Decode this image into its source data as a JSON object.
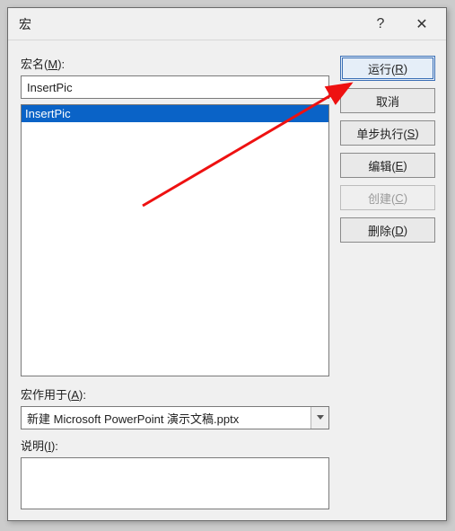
{
  "titlebar": {
    "title": "宏",
    "help_icon": "?",
    "close_icon": "✕"
  },
  "left_panel": {
    "name_label_prefix": "宏名(",
    "name_label_key": "M",
    "name_label_suffix": "):",
    "name_value": "InsertPic",
    "list_items": [
      "InsertPic"
    ],
    "selected_index": 0,
    "scope_label_prefix": "宏作用于(",
    "scope_label_key": "A",
    "scope_label_suffix": "):",
    "scope_value": "新建 Microsoft PowerPoint 演示文稿.pptx",
    "desc_label_prefix": "说明(",
    "desc_label_key": "I",
    "desc_label_suffix": "):"
  },
  "buttons": {
    "run": {
      "text_prefix": "运行(",
      "key": "R",
      "text_suffix": ")",
      "enabled": true,
      "focus": true
    },
    "cancel": {
      "text": "取消",
      "enabled": true
    },
    "step": {
      "text_prefix": "单步执行(",
      "key": "S",
      "text_suffix": ")",
      "enabled": true
    },
    "edit": {
      "text_prefix": "编辑(",
      "key": "E",
      "text_suffix": ")",
      "enabled": true
    },
    "create": {
      "text_prefix": "创建(",
      "key": "C",
      "text_suffix": ")",
      "enabled": false
    },
    "delete": {
      "text_prefix": "删除(",
      "key": "D",
      "text_suffix": ")",
      "enabled": true
    }
  }
}
